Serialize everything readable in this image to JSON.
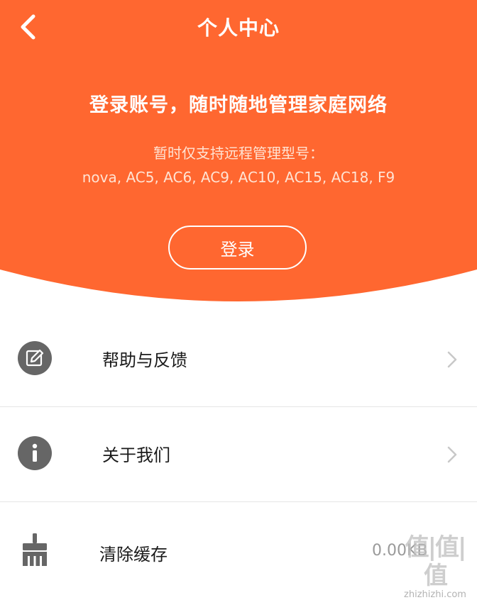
{
  "header": {
    "title": "个人中心",
    "headline": "登录账号，随时随地管理家庭网络",
    "support_text": "暂时仅支持远程管理型号：",
    "models": "nova, AC5, AC6, AC9, AC10, AC15, AC18, F9",
    "login_label": "登录",
    "back_icon": "chevron-left-icon"
  },
  "colors": {
    "brand": "#ff6730",
    "icon_gray": "#666666",
    "divider": "#e6e6e6",
    "chevron": "#c8c8c8"
  },
  "menu": [
    {
      "label": "帮助与反馈",
      "icon": "edit-icon"
    },
    {
      "label": "关于我们",
      "icon": "info-icon"
    },
    {
      "label": "清除缓存",
      "icon": "broom-icon",
      "value": "0.00KB"
    }
  ],
  "watermark": {
    "main": "值|值|值",
    "sub": "zhizhizhi.com"
  }
}
